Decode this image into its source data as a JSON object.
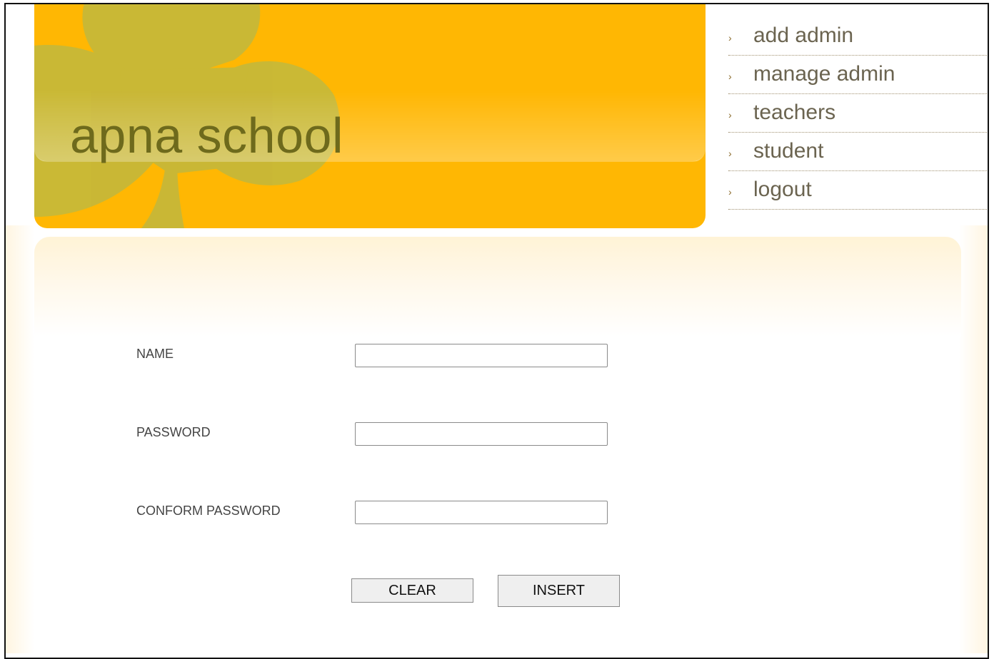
{
  "header": {
    "site_title": "apna school"
  },
  "nav": {
    "items": [
      {
        "label": "add admin"
      },
      {
        "label": "manage admin"
      },
      {
        "label": "teachers"
      },
      {
        "label": "student"
      },
      {
        "label": "logout"
      }
    ],
    "bullet": "›"
  },
  "form": {
    "name_label": "NAME",
    "name_value": "",
    "password_label": "PASSWORD",
    "password_value": "",
    "confirm_label": "CONFORM PASSWORD",
    "confirm_value": "",
    "clear_button": "CLEAR",
    "insert_button": "INSERT"
  },
  "colors": {
    "banner": "#ffb703",
    "clover": "#c7b93a",
    "title_text": "#6e6a1c",
    "nav_text": "#6b6450"
  }
}
